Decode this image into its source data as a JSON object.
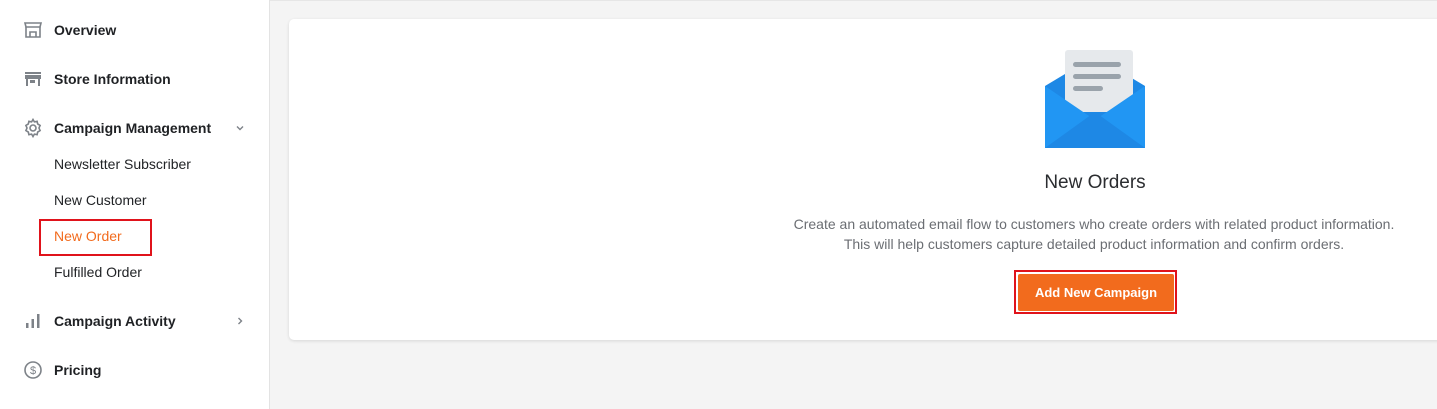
{
  "sidebar": {
    "items": [
      {
        "label": "Overview",
        "icon": "storefront-icon"
      },
      {
        "label": "Store Information",
        "icon": "store-icon"
      },
      {
        "label": "Campaign Management",
        "icon": "gear-icon",
        "expanded": true,
        "children": [
          {
            "label": "Newsletter Subscriber"
          },
          {
            "label": "New Customer"
          },
          {
            "label": "New Order",
            "active": true
          },
          {
            "label": "Fulfilled Order"
          }
        ]
      },
      {
        "label": "Campaign Activity",
        "icon": "bar-chart-icon",
        "expanded": false
      },
      {
        "label": "Pricing",
        "icon": "dollar-circle-icon"
      }
    ]
  },
  "main": {
    "title": "New Orders",
    "description_line1": "Create an automated email flow to customers who create orders with related product information.",
    "description_line2": "This will help customers capture detailed product information and confirm orders.",
    "cta_label": "Add New Campaign",
    "illustration": "email-envelope-icon"
  },
  "colors": {
    "accent": "#f26b1d",
    "highlight": "#e0131b",
    "envelope_blue": "#2196f3",
    "envelope_dark_blue": "#1e88e5"
  }
}
